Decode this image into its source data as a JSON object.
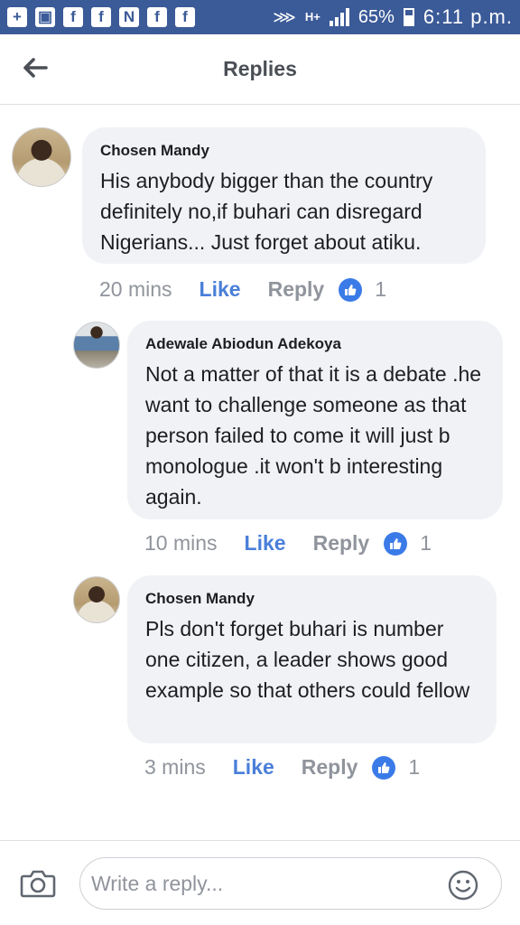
{
  "status_bar": {
    "left_icons": [
      "plus-box-icon",
      "image-icon",
      "facebook-icon",
      "facebook-icon",
      "n-icon",
      "facebook-icon",
      "facebook-icon"
    ],
    "network": "H+",
    "battery": "65%",
    "time": "6:11 p.m."
  },
  "header": {
    "title": "Replies"
  },
  "comments": [
    {
      "author": "Chosen Mandy",
      "text": "His anybody bigger than the country definitely no,if buhari can disregard Nigerians... Just forget about atiku.",
      "time": "20 mins",
      "like_label": "Like",
      "reply_label": "Reply",
      "like_count": "1"
    },
    {
      "author": "Adewale Abiodun Adekoya",
      "text": "Not a matter of that it is a debate .he want to challenge   someone as that person failed to come it will just b monologue .it won't b interesting again.",
      "time": "10 mins",
      "like_label": "Like",
      "reply_label": "Reply",
      "like_count": "1"
    },
    {
      "author": "Chosen Mandy",
      "text": "Pls don't forget buhari is number one citizen, a leader shows good example so that others could fellow",
      "time": "3 mins",
      "like_label": "Like",
      "reply_label": "Reply",
      "like_count": "1"
    }
  ],
  "composer": {
    "placeholder": "Write a reply..."
  },
  "colors": {
    "status_bar": "#3b5a98",
    "like_blue": "#4a7fd9",
    "bubble": "#f0f2f5"
  }
}
